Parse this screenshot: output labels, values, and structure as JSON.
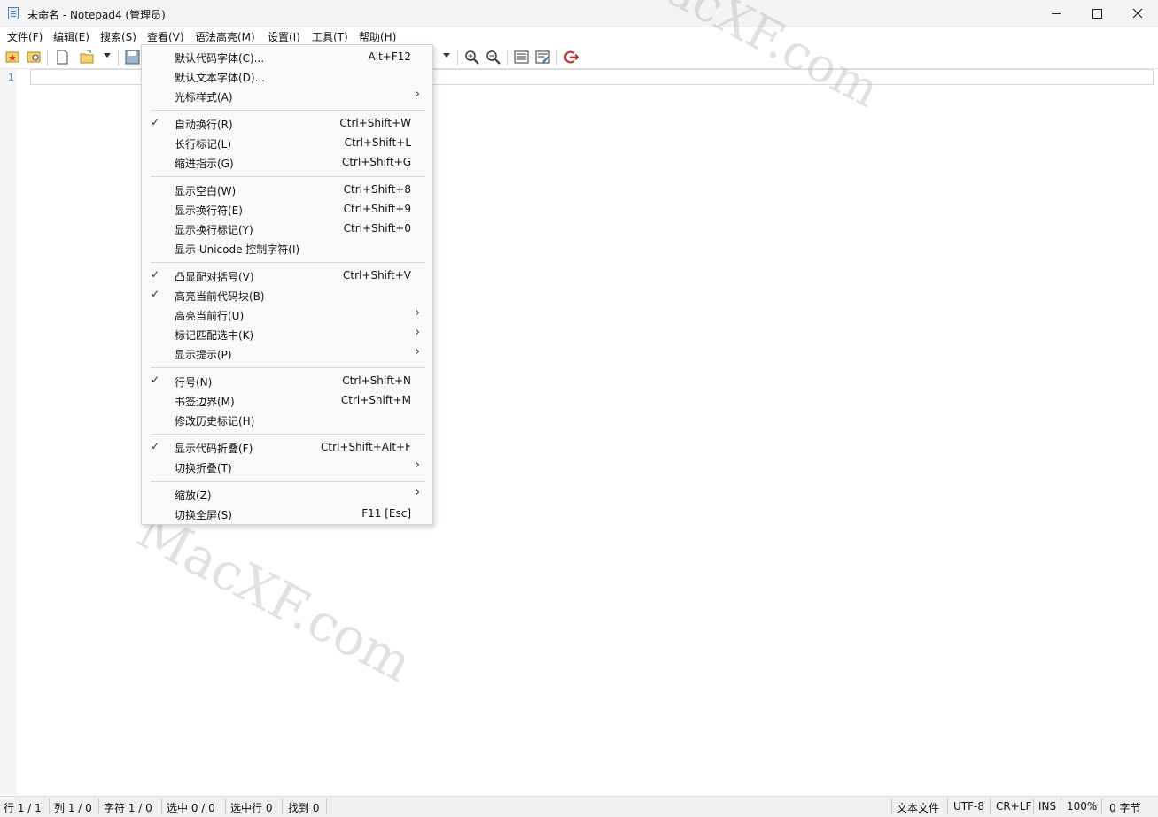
{
  "window": {
    "title": "未命名 - Notepad4 (管理员)"
  },
  "menubar": [
    {
      "label": "文件(F)"
    },
    {
      "label": "编辑(E)"
    },
    {
      "label": "搜索(S)"
    },
    {
      "label": "查看(V)"
    },
    {
      "label": "语法高亮(M)"
    },
    {
      "label": "设置(I)"
    },
    {
      "label": "工具(T)"
    },
    {
      "label": "帮助(H)"
    }
  ],
  "editor": {
    "line_number": "1"
  },
  "view_menu": [
    {
      "label": "默认代码字体(C)...",
      "shortcut": "Alt+F12"
    },
    {
      "label": "默认文本字体(D)...",
      "shortcut": ""
    },
    {
      "label": "光标样式(A)",
      "shortcut": ""
    },
    {
      "label": "自动换行(R)",
      "shortcut": "Ctrl+Shift+W"
    },
    {
      "label": "长行标记(L)",
      "shortcut": "Ctrl+Shift+L"
    },
    {
      "label": "缩进指示(G)",
      "shortcut": "Ctrl+Shift+G"
    },
    {
      "label": "显示空白(W)",
      "shortcut": "Ctrl+Shift+8"
    },
    {
      "label": "显示换行符(E)",
      "shortcut": "Ctrl+Shift+9"
    },
    {
      "label": "显示换行标记(Y)",
      "shortcut": "Ctrl+Shift+0"
    },
    {
      "label": "显示 Unicode 控制字符(I)",
      "shortcut": ""
    },
    {
      "label": "凸显配对括号(V)",
      "shortcut": "Ctrl+Shift+V"
    },
    {
      "label": "高亮当前代码块(B)",
      "shortcut": ""
    },
    {
      "label": "高亮当前行(U)",
      "shortcut": ""
    },
    {
      "label": "标记匹配选中(K)",
      "shortcut": ""
    },
    {
      "label": "显示提示(P)",
      "shortcut": ""
    },
    {
      "label": "行号(N)",
      "shortcut": "Ctrl+Shift+N"
    },
    {
      "label": "书签边界(M)",
      "shortcut": "Ctrl+Shift+M"
    },
    {
      "label": "修改历史标记(H)",
      "shortcut": ""
    },
    {
      "label": "显示代码折叠(F)",
      "shortcut": "Ctrl+Shift+Alt+F"
    },
    {
      "label": "切换折叠(T)",
      "shortcut": ""
    },
    {
      "label": "缩放(Z)",
      "shortcut": ""
    },
    {
      "label": "切换全屏(S)",
      "shortcut": "F11 [Esc]"
    }
  ],
  "view_menu_checked": [
    "自动换行(R)",
    "凸显配对括号(V)",
    "高亮当前代码块(B)",
    "行号(N)",
    "显示代码折叠(F)"
  ],
  "view_menu_submenus": [
    "光标样式(A)",
    "高亮当前行(U)",
    "标记匹配选中(K)",
    "显示提示(P)",
    "切换折叠(T)",
    "缩放(Z)"
  ],
  "statusbar": {
    "line": "行 1 / 1",
    "column": "列 1 / 0",
    "char": "字符 1 / 0",
    "selection": "选中 0 / 0",
    "selected_lines": "选中行 0",
    "found": "找到 0",
    "file_type": "文本文件",
    "encoding": "UTF-8",
    "eol": "CR+LF",
    "mode": "INS",
    "zoom": "100%",
    "size": "0 字节"
  },
  "watermark": {
    "text": "MacXF.com"
  },
  "icons": {
    "toolbar": [
      "favorites-icon",
      "browse-icon",
      "new-file-icon",
      "open-file-icon",
      "save-icon",
      "zoom-in-icon",
      "zoom-out-icon",
      "scheme-icon",
      "customize-scheme-icon",
      "exit-icon"
    ]
  },
  "colors": {
    "line_number": "#3b7dc4",
    "exit_icon": "#c0282d",
    "menu_bg": "#f9f9f9"
  }
}
